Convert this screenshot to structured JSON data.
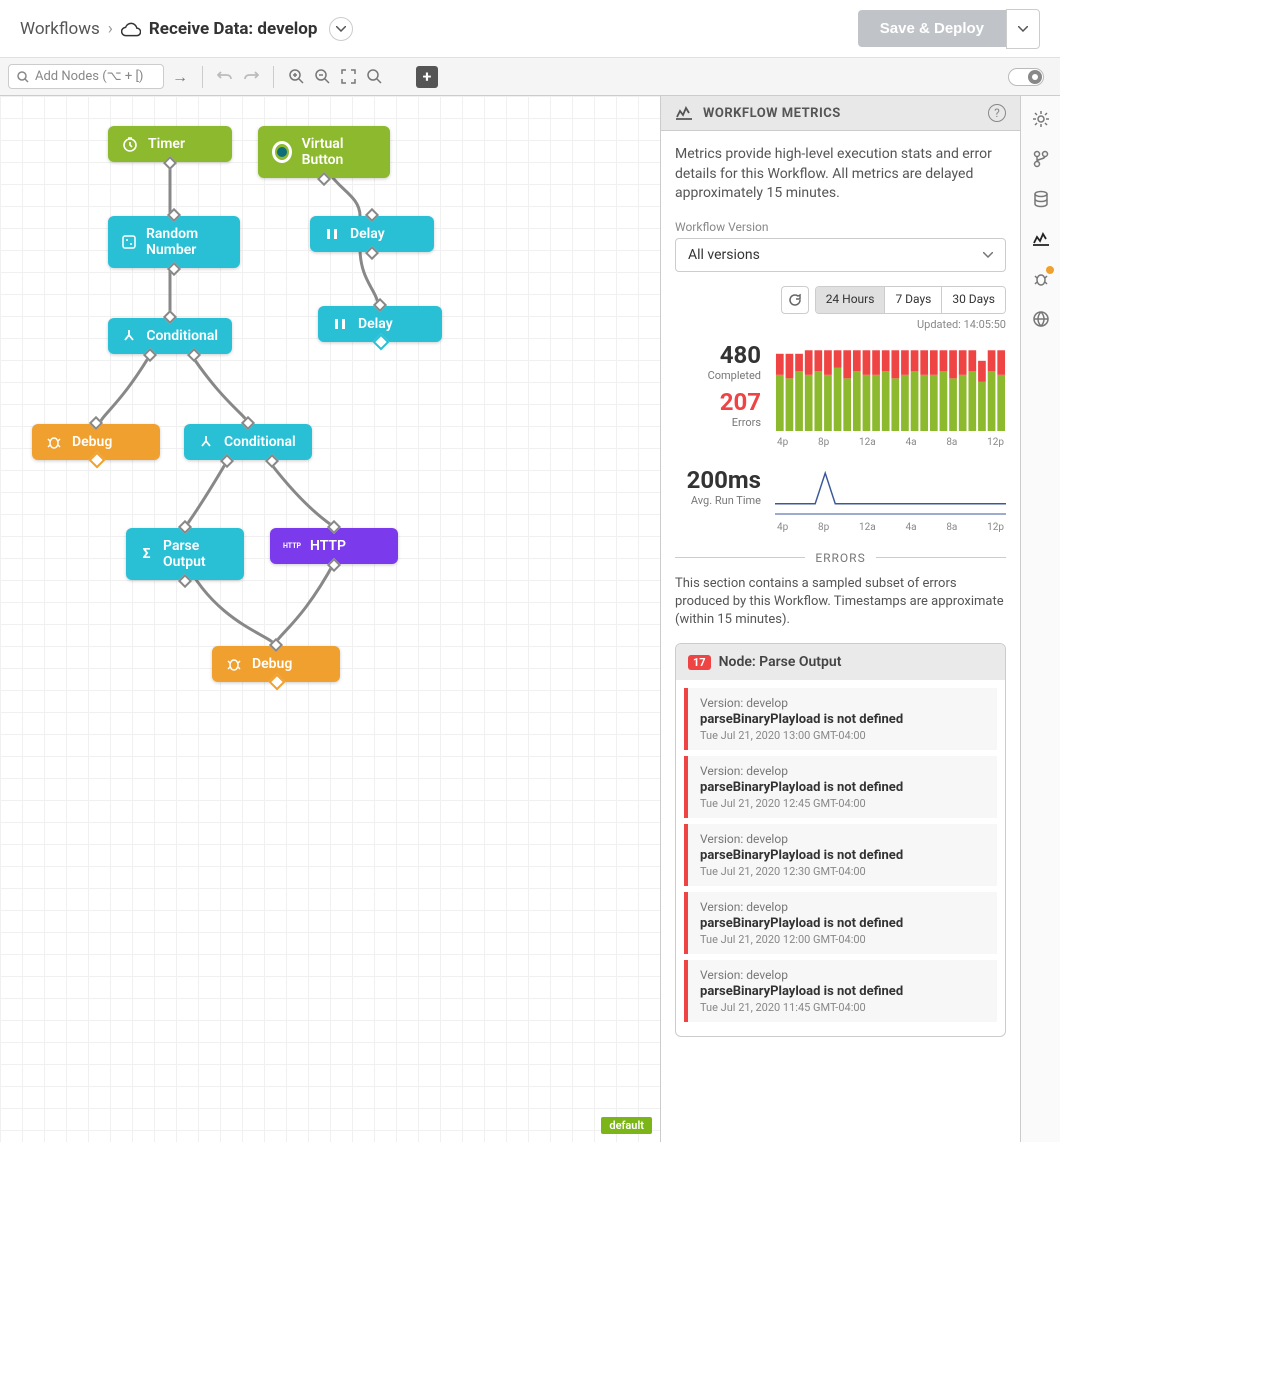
{
  "breadcrumb": {
    "root": "Workflows",
    "title": "Receive Data: develop"
  },
  "header": {
    "save_label": "Save & Deploy"
  },
  "toolbar": {
    "add_nodes_placeholder": "Add Nodes (⌥ + [)"
  },
  "canvas": {
    "default_badge": "default",
    "nodes": {
      "timer": "Timer",
      "virtual_button": "Virtual Button",
      "random_number": "Random Number",
      "delay1": "Delay",
      "conditional1": "Conditional",
      "delay2": "Delay",
      "debug1": "Debug",
      "conditional2": "Conditional",
      "parse_output": "Parse Output",
      "http": "HTTP",
      "debug2": "Debug"
    }
  },
  "panel": {
    "title": "WORKFLOW METRICS",
    "description": "Metrics provide high-level execution stats and error details for this Workflow. All metrics are delayed approximately 15 minutes.",
    "version_label": "Workflow Version",
    "version_value": "All versions",
    "ranges": [
      "24 Hours",
      "7 Days",
      "30 Days"
    ],
    "active_range": 0,
    "updated": "Updated: 14:05:50",
    "completed_value": "480",
    "completed_label": "Completed",
    "errors_value": "207",
    "errors_label": "Errors",
    "runtime_value": "200ms",
    "runtime_label": "Avg. Run Time",
    "chart_ticks": [
      "4p",
      "8p",
      "12a",
      "4a",
      "8a",
      "12p"
    ],
    "errors_section_label": "ERRORS",
    "errors_section_desc": "This section contains a sampled subset of errors produced by this Workflow. Timestamps are approximate (within 15 minutes).",
    "error_group": {
      "count": "17",
      "title": "Node: Parse Output",
      "items": [
        {
          "version": "Version: develop",
          "message": "parseBinaryPlayload is not defined",
          "timestamp": "Tue Jul 21, 2020 13:00 GMT-04:00"
        },
        {
          "version": "Version: develop",
          "message": "parseBinaryPlayload is not defined",
          "timestamp": "Tue Jul 21, 2020 12:45 GMT-04:00"
        },
        {
          "version": "Version: develop",
          "message": "parseBinaryPlayload is not defined",
          "timestamp": "Tue Jul 21, 2020 12:30 GMT-04:00"
        },
        {
          "version": "Version: develop",
          "message": "parseBinaryPlayload is not defined",
          "timestamp": "Tue Jul 21, 2020 12:00 GMT-04:00"
        },
        {
          "version": "Version: develop",
          "message": "parseBinaryPlayload is not defined",
          "timestamp": "Tue Jul 21, 2020 11:45 GMT-04:00"
        }
      ]
    }
  },
  "chart_data": {
    "completed_errors": {
      "type": "bar",
      "title": "Completed vs Errors (24 Hours)",
      "xlabel": "",
      "ylabel": "",
      "categories": [
        "4p",
        "",
        "",
        "",
        "8p",
        "",
        "",
        "",
        "12a",
        "",
        "",
        "",
        "4a",
        "",
        "",
        "",
        "8a",
        "",
        "",
        "",
        "12p",
        "",
        "",
        ""
      ],
      "series": [
        {
          "name": "Completed",
          "values": [
            16,
            15,
            17,
            16,
            17,
            16,
            18,
            15,
            17,
            16,
            16,
            17,
            15,
            16,
            17,
            16,
            16,
            17,
            15,
            16,
            17,
            14,
            17,
            16
          ],
          "color": "#8db92e"
        },
        {
          "name": "Errors",
          "values": [
            6,
            7,
            5,
            7,
            6,
            7,
            5,
            8,
            6,
            7,
            7,
            6,
            8,
            7,
            6,
            7,
            7,
            6,
            8,
            7,
            6,
            6,
            6,
            7
          ],
          "color": "#ef4444"
        }
      ],
      "ylim": [
        0,
        25
      ]
    },
    "runtime": {
      "type": "line",
      "title": "Avg. Run Time (24 Hours)",
      "xlabel": "",
      "ylabel": "ms",
      "x": [
        "4p",
        "",
        "",
        "",
        "8p",
        "",
        "",
        "",
        "12a",
        "",
        "",
        "",
        "4a",
        "",
        "",
        "",
        "8a",
        "",
        "",
        "",
        "12p",
        "",
        "",
        ""
      ],
      "values": [
        200,
        200,
        200,
        200,
        200,
        800,
        200,
        200,
        200,
        200,
        200,
        200,
        200,
        200,
        200,
        200,
        200,
        200,
        200,
        200,
        200,
        200,
        200,
        200
      ],
      "ylim": [
        0,
        900
      ]
    }
  },
  "colors": {
    "green": "#8db92e",
    "cyan": "#29c0d6",
    "orange": "#f0a02f",
    "purple": "#7c3aed",
    "red": "#ef4444"
  }
}
